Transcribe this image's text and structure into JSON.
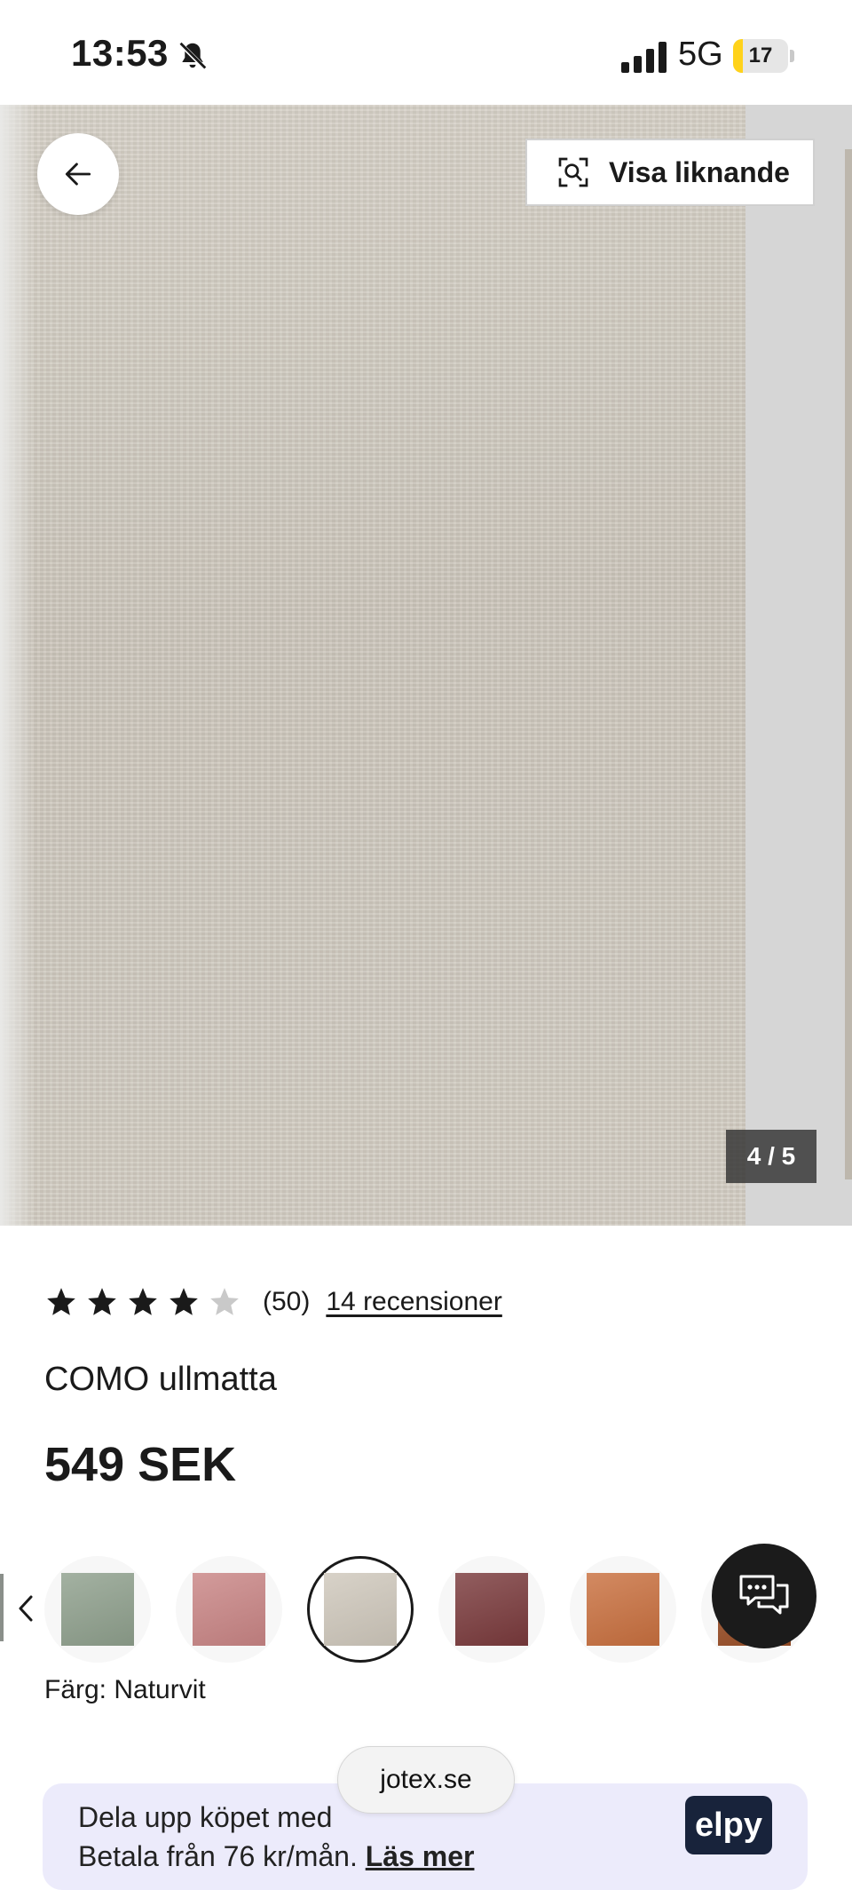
{
  "status_bar": {
    "time": "13:53",
    "network": "5G",
    "battery_level": "17",
    "battery_color": "#ffd21a"
  },
  "gallery": {
    "similar_button_label": "Visa liknande",
    "counter": "4 / 5",
    "back_icon": "arrow-left-icon",
    "similar_icon": "visual-search-icon"
  },
  "product": {
    "rating": 4,
    "rating_max": 5,
    "rating_count": "(50)",
    "reviews_link": "14 recensioner",
    "title": "COMO ullmatta",
    "price": "549 SEK",
    "color_label": "Färg: Naturvit"
  },
  "swatches": [
    {
      "name": "green",
      "color": "#8fa08d",
      "selected": false
    },
    {
      "name": "rose",
      "color": "#c98585",
      "selected": false
    },
    {
      "name": "natural-white",
      "color": "#cfc8bc",
      "selected": true
    },
    {
      "name": "burgundy",
      "color": "#7a3a3c",
      "selected": false
    },
    {
      "name": "rust",
      "color": "#c9703f",
      "selected": false
    },
    {
      "name": "brown",
      "color": "#9a4e26",
      "selected": false
    }
  ],
  "payment": {
    "line1": "Dela upp köpet med",
    "line2": "Betala från 76 kr/mån.",
    "read_more": "Läs mer",
    "logo_text": "elpy"
  },
  "browser": {
    "url": "jotex.se"
  }
}
